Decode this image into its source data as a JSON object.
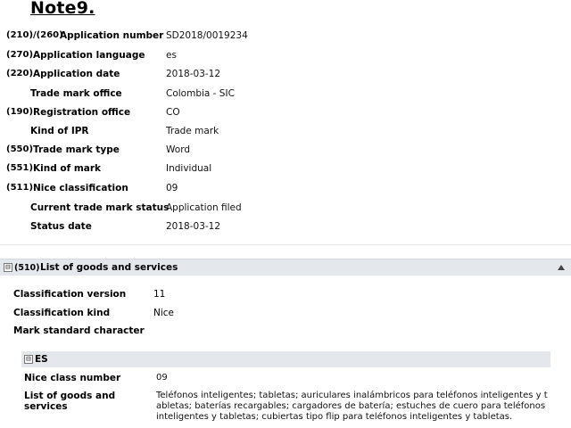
{
  "title": "Note9.",
  "fields": [
    {
      "code": "(210)/(260)",
      "label": "Application number",
      "value": "SD2018/0019234"
    },
    {
      "code": "(270)",
      "label": "Application language",
      "value": "es"
    },
    {
      "code": "(220)",
      "label": "Application date",
      "value": "2018-03-12"
    },
    {
      "code": "",
      "label": "Trade mark office",
      "value": "Colombia - SIC"
    },
    {
      "code": "(190)",
      "label": "Registration office",
      "value": "CO"
    },
    {
      "code": "",
      "label": "Kind of IPR",
      "value": "Trade mark"
    },
    {
      "code": "(550)",
      "label": "Trade mark type",
      "value": "Word"
    },
    {
      "code": "(551)",
      "label": "Kind of mark",
      "value": "Individual"
    },
    {
      "code": "(511)",
      "label": "Nice classification",
      "value": "09"
    },
    {
      "code": "",
      "label": "Current trade mark status",
      "value": "Application filed"
    },
    {
      "code": "",
      "label": "Status date",
      "value": "2018-03-12"
    }
  ],
  "goods_section": {
    "toggle": "⊟",
    "code": "(510)",
    "title": "List of goods and services",
    "meta": [
      {
        "label": "Classification version",
        "value": "11"
      },
      {
        "label": "Classification kind",
        "value": "Nice"
      },
      {
        "label": "Mark standard character",
        "value": ""
      }
    ],
    "language": {
      "toggle": "⊟",
      "title": "ES",
      "nice_class_label": "Nice class number",
      "nice_class_value": "09",
      "goods_label": "List of goods and services",
      "goods_value": "Teléfonos inteligentes; tabletas; auriculares inalámbricos para teléfonos inteligentes y tabletas; baterías recargables; cargadores de batería; estuches de cuero para teléfonos inteligentes y tabletas; cubiertas tipo flip para teléfonos inteligentes y tabletas."
    }
  }
}
